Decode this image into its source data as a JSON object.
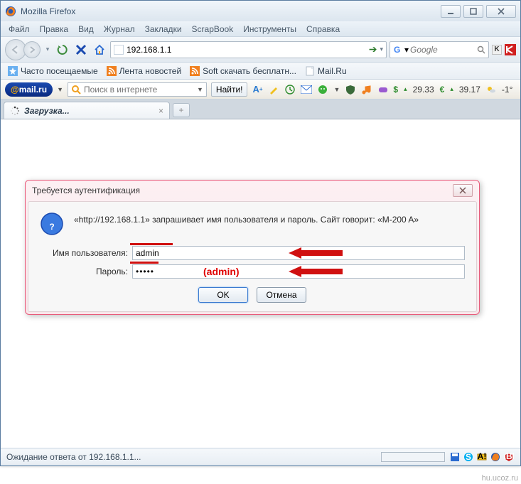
{
  "window": {
    "title": "Mozilla Firefox"
  },
  "menu": {
    "file": "Файл",
    "edit": "Правка",
    "view": "Вид",
    "history": "Журнал",
    "bookmarks": "Закладки",
    "scrapbook": "ScrapBook",
    "tools": "Инструменты",
    "help": "Справка"
  },
  "nav": {
    "url": "192.168.1.1",
    "search_placeholder": "Google"
  },
  "bookmarks": {
    "most_visited": "Часто посещаемые",
    "news": "Лента новостей",
    "soft": "Soft скачать бесплатн...",
    "mailru": "Mail.Ru"
  },
  "mailbar": {
    "logo_at": "@",
    "logo_text": "mail.ru",
    "search_placeholder": "Поиск в интернете",
    "find": "Найти!",
    "rate_usd_sym": "$",
    "rate_usd": "29.33",
    "rate_eur_sym": "€",
    "rate_eur": "39.17",
    "temp": "-1°"
  },
  "tab": {
    "label": "Загрузка...",
    "new": "+"
  },
  "dialog": {
    "title": "Требуется аутентификация",
    "message": "«http://192.168.1.1» запрашивает имя пользователя и пароль. Сайт говорит: «M-200 A»",
    "user_label": "Имя пользователя:",
    "user_value": "admin",
    "pass_label": "Пароль:",
    "pass_value": "•••••",
    "pass_hint": "(admin)",
    "ok": "OK",
    "cancel": "Отмена"
  },
  "status": {
    "text": "Ожидание ответа от 192.168.1.1..."
  },
  "watermark": "hu.ucoz.ru"
}
